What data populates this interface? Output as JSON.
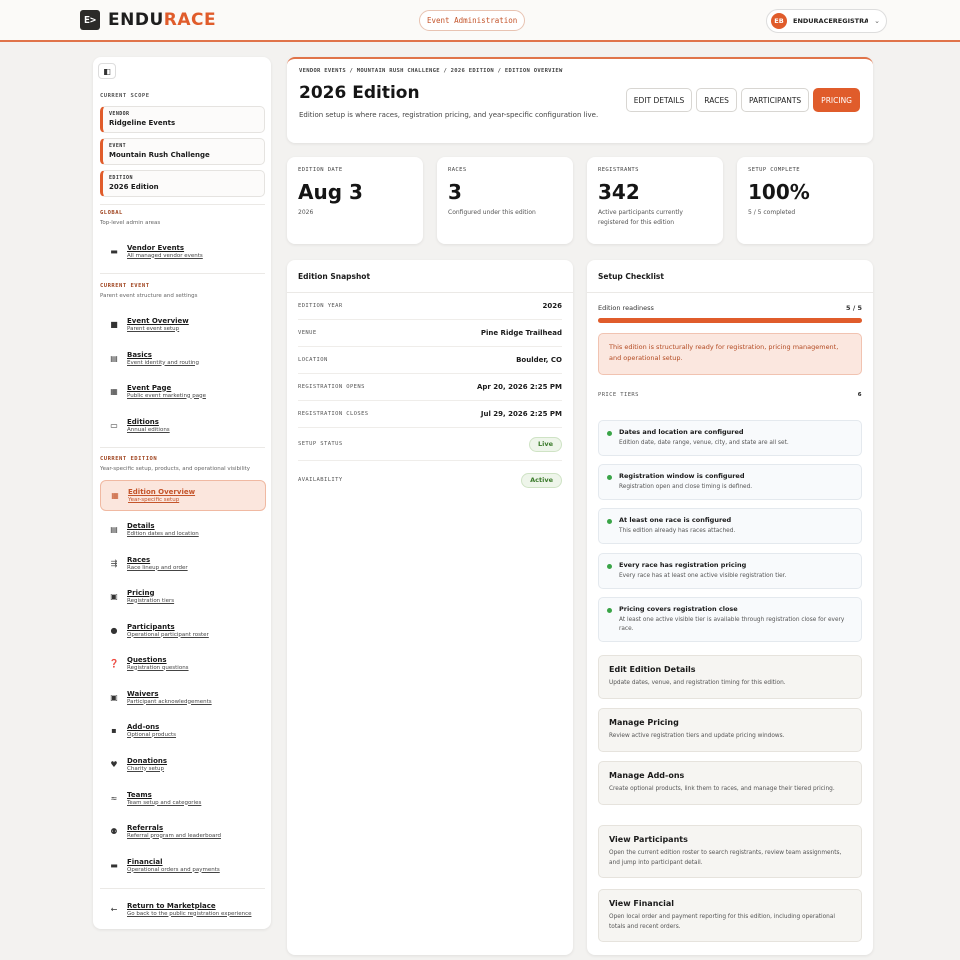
{
  "brand": {
    "logo_mark": "E>",
    "name_a": "ENDU",
    "name_b": "RACE"
  },
  "env": {
    "label": "Event Administration"
  },
  "user": {
    "initials": "EB",
    "name": "ENDURACEREGISTRAT..."
  },
  "sidebar": {
    "current_scope_label": "CURRENT SCOPE",
    "scope": [
      {
        "key": "VENDOR",
        "value": "Ridgeline Events"
      },
      {
        "key": "EVENT",
        "value": "Mountain Rush Challenge"
      },
      {
        "key": "EDITION",
        "value": "2026 Edition"
      }
    ],
    "global": {
      "label": "GLOBAL",
      "sub": "Top-level admin areas"
    },
    "global_items": [
      {
        "title": "Vendor Events",
        "sub": "All managed vendor events",
        "icon": "list-icon"
      }
    ],
    "current_event": {
      "label": "CURRENT EVENT",
      "sub": "Parent event structure and settings"
    },
    "event_items": [
      {
        "title": "Event Overview",
        "sub": "Parent event setup",
        "icon": "folder-icon"
      },
      {
        "title": "Basics",
        "sub": "Event identity and routing",
        "icon": "id-card-icon"
      },
      {
        "title": "Event Page",
        "sub": "Public event marketing page",
        "icon": "page-icon"
      },
      {
        "title": "Editions",
        "sub": "Annual editions",
        "icon": "calendar-icon"
      }
    ],
    "current_edition": {
      "label": "CURRENT EDITION",
      "sub": "Year-specific setup, products, and operational visibility"
    },
    "edition_items": [
      {
        "title": "Edition Overview",
        "sub": "Year-specific setup",
        "icon": "dashboard-icon"
      },
      {
        "title": "Details",
        "sub": "Edition dates and location",
        "icon": "document-icon"
      },
      {
        "title": "Races",
        "sub": "Race lineup and order",
        "icon": "route-icon"
      },
      {
        "title": "Pricing",
        "sub": "Registration tiers",
        "icon": "price-tag-icon"
      },
      {
        "title": "Participants",
        "sub": "Operational participant roster",
        "icon": "person-icon"
      },
      {
        "title": "Questions",
        "sub": "Registration questions",
        "icon": "question-icon"
      },
      {
        "title": "Waivers",
        "sub": "Participant acknowledgements",
        "icon": "waiver-icon"
      },
      {
        "title": "Add-ons",
        "sub": "Optional products",
        "icon": "bag-icon"
      },
      {
        "title": "Donations",
        "sub": "Charity setup",
        "icon": "heart-icon"
      },
      {
        "title": "Teams",
        "sub": "Team setup and categories",
        "icon": "teams-icon"
      },
      {
        "title": "Referrals",
        "sub": "Referral program and leaderboard",
        "icon": "people-icon"
      },
      {
        "title": "Financial",
        "sub": "Operational orders and payments",
        "icon": "card-icon"
      }
    ],
    "return": {
      "title": "Return to Marketplace",
      "sub": "Go back to the public registration experience"
    }
  },
  "header": {
    "breadcrumb": "VENDOR EVENTS / MOUNTAIN RUSH CHALLENGE / 2026 EDITION / EDITION OVERVIEW",
    "title": "2026 Edition",
    "description": "Edition setup is where races, registration pricing, and year-specific configuration live.",
    "buttons": [
      "EDIT DETAILS",
      "RACES",
      "PARTICIPANTS",
      "PRICING"
    ]
  },
  "stats": [
    {
      "label": "EDITION DATE",
      "value": "Aug 3",
      "sub": "2026"
    },
    {
      "label": "RACES",
      "value": "3",
      "sub": "Configured under this edition"
    },
    {
      "label": "REGISTRANTS",
      "value": "342",
      "sub": "Active participants currently registered for this edition"
    },
    {
      "label": "SETUP COMPLETE",
      "value": "100%",
      "sub": "5 / 5 completed"
    }
  ],
  "snapshot": {
    "title": "Edition Snapshot",
    "rows": [
      {
        "k": "EDITION YEAR",
        "v": "2026"
      },
      {
        "k": "VENUE",
        "v": "Pine Ridge Trailhead"
      },
      {
        "k": "LOCATION",
        "v": "Boulder, CO"
      },
      {
        "k": "REGISTRATION OPENS",
        "v": "Apr 20, 2026 2:25 PM"
      },
      {
        "k": "REGISTRATION CLOSES",
        "v": "Jul 29, 2026 2:25 PM"
      },
      {
        "k": "SETUP STATUS",
        "v": "Live"
      },
      {
        "k": "AVAILABILITY",
        "v": "Active"
      }
    ]
  },
  "checklist": {
    "title": "Setup Checklist",
    "readiness_label": "Edition readiness",
    "readiness_value": "5 / 5",
    "readiness_fraction": 1.0,
    "alert": "This edition is structurally ready for registration, pricing management, and operational setup.",
    "tiers_label": "PRICE TIERS",
    "tiers_count": "6",
    "items": [
      {
        "title": "Dates and location are configured",
        "desc": "Edition date, date range, venue, city, and state are all set."
      },
      {
        "title": "Registration window is configured",
        "desc": "Registration open and close timing is defined."
      },
      {
        "title": "At least one race is configured",
        "desc": "This edition already has races attached."
      },
      {
        "title": "Every race has registration pricing",
        "desc": "Every race has at least one active visible registration tier."
      },
      {
        "title": "Pricing covers registration close",
        "desc": "At least one active visible tier is available through registration close for every race."
      }
    ],
    "actions": [
      {
        "title": "Edit Edition Details",
        "desc": "Update dates, venue, and registration timing for this edition."
      },
      {
        "title": "Manage Pricing",
        "desc": "Review active registration tiers and update pricing windows."
      },
      {
        "title": "Manage Add-ons",
        "desc": "Create optional products, link them to races, and manage their tiered pricing."
      },
      {
        "title": "View Participants",
        "desc": "Open the current edition roster to search registrants, review team assignments, and jump into participant detail."
      },
      {
        "title": "View Financial",
        "desc": "Open local order and payment reporting for this edition, including operational totals and recent orders."
      }
    ]
  },
  "colors": {
    "accent": "#e05c2b",
    "success": "#3aa447"
  }
}
